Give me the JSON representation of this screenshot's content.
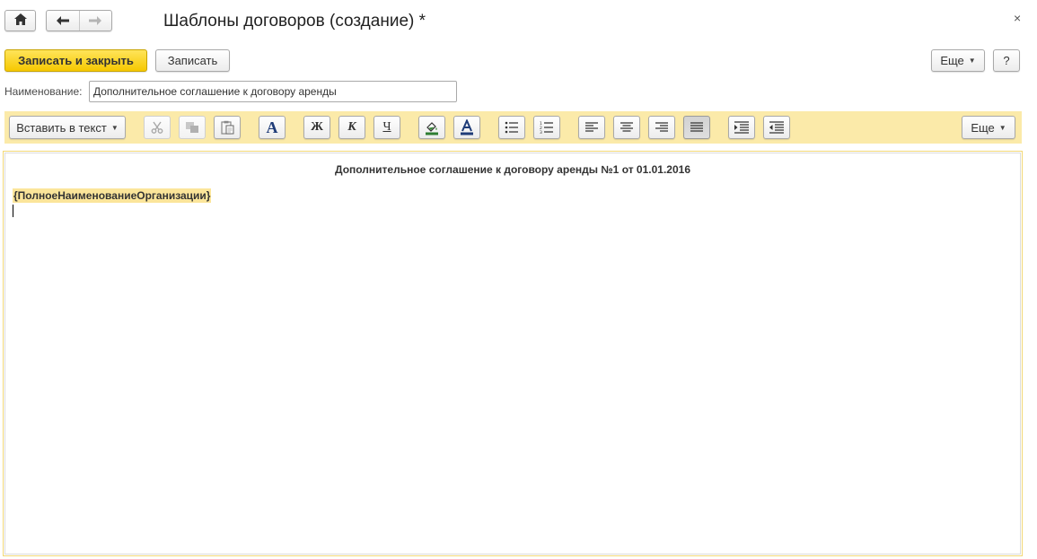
{
  "window": {
    "title": "Шаблоны договоров (создание) *",
    "close_glyph": "×",
    "icons": {
      "home": "home-icon",
      "back": "arrow-left-icon",
      "forward": "arrow-right-icon"
    }
  },
  "commands": {
    "save_close_label": "Записать и закрыть",
    "save_label": "Записать",
    "more_label": "Еще",
    "help_label": "?"
  },
  "form": {
    "name_label": "Наименование:",
    "name_value": "Дополнительное соглашение к договору аренды"
  },
  "toolbar": {
    "insert_label": "Вставить в текст",
    "more_label": "Еще",
    "bold_glyph": "Ж",
    "italic_glyph": "К",
    "underline_glyph": "Ч",
    "font_glyph": "A",
    "active_alignment": "justify"
  },
  "editor": {
    "heading": "Дополнительное соглашение к договору аренды №1 от 01.01.2016",
    "field_tag": "{ПолноеНаименованиеОрганизации}"
  },
  "colors": {
    "accent_yellow": "#f6c800",
    "toolbar_bg": "#fbeaa9",
    "field_highlight": "#fbe59a"
  }
}
